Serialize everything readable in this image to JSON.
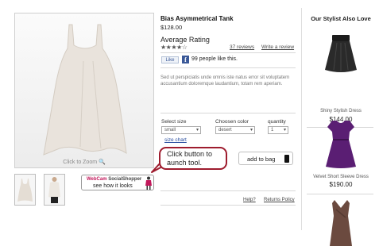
{
  "product": {
    "title": "Bias Asymmetrical Tank",
    "price": "$128.00",
    "rating_label": "Average Rating",
    "stars": "★★★★☆",
    "reviews_link": "37 reviews",
    "write_review_link": "Write a review",
    "like_button": "Like",
    "like_text": "99 people like this.",
    "description": "Sed ut perspiciatis unde omnis iste natus error sit voluptatem accusantium doloremque laudantium, totam rem aperiam.",
    "zoom_hint": "Click to Zoom 🔍"
  },
  "options": {
    "size_label": "Select size",
    "size_value": "small",
    "color_label": "Choosen color",
    "color_value": "desert",
    "qty_label": "quantity",
    "qty_value": "1",
    "size_chart_link": "size chart"
  },
  "tooltip": {
    "line1": "Click button to",
    "line2": "aunch tool."
  },
  "add_to_bag": "add to bag",
  "webcam": {
    "brand": "WebCam",
    "product": "SocialShopper",
    "tagline": "see how it looks"
  },
  "footer_links": {
    "help": "Help?",
    "returns": "Returns Policy"
  },
  "stylist": {
    "title": "Our Stylist Also Love",
    "items": [
      {
        "name": "Shiny Stylish Dress",
        "price": "$144.00"
      },
      {
        "name": "Velvet Short Sleeve Dress",
        "price": "$190.00"
      },
      {
        "name": "",
        "price": ""
      }
    ]
  },
  "colors": {
    "tooltip_border": "#9e1c2e",
    "facebook": "#3b5998",
    "accent_pink": "#c2185b",
    "dress_purple": "#5a1e73"
  }
}
